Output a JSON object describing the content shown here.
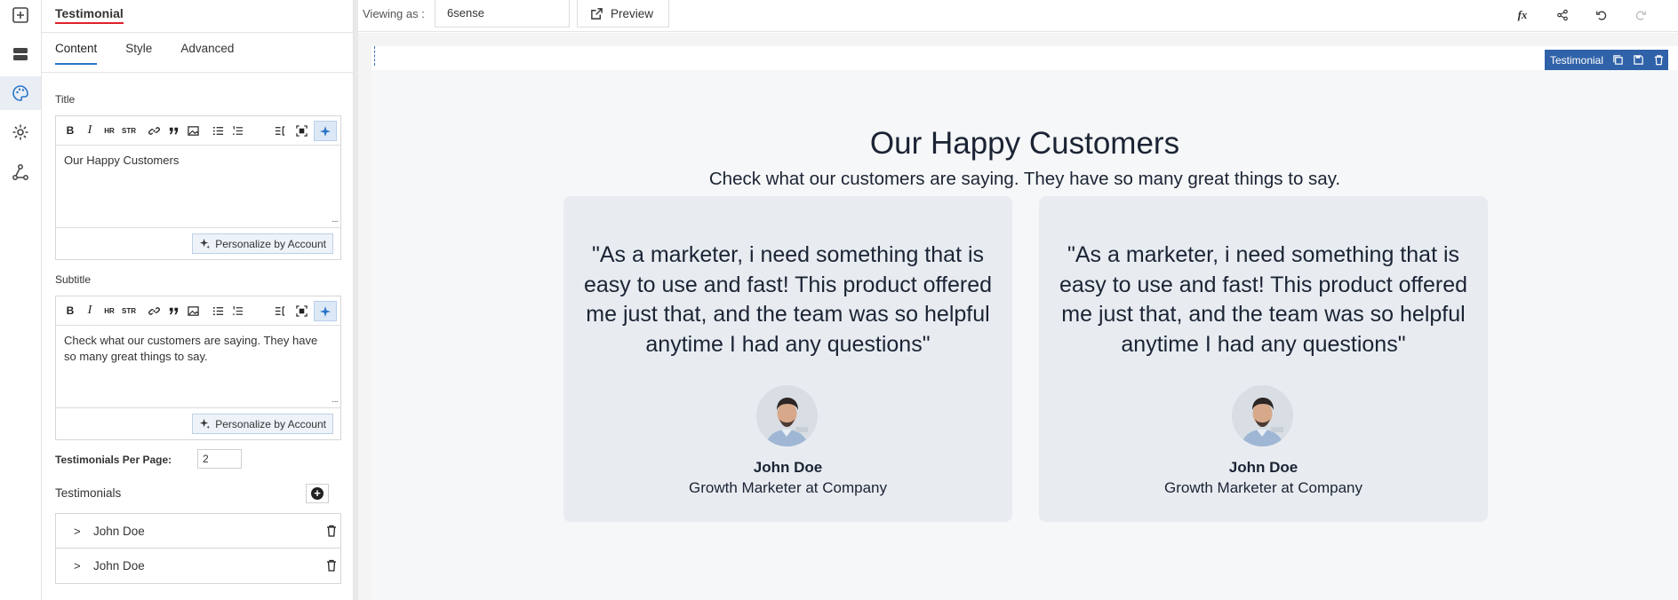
{
  "rail": {
    "icons": [
      "add-icon",
      "layout-icon",
      "palette-icon",
      "settings-icon",
      "flow-icon"
    ]
  },
  "panel": {
    "title": "Testimonial",
    "tabs": [
      {
        "label": "Content",
        "active": true
      },
      {
        "label": "Style",
        "active": false
      },
      {
        "label": "Advanced",
        "active": false
      }
    ],
    "title_field": {
      "label": "Title",
      "value": "Our Happy Customers",
      "personalize_label": "Personalize by Account"
    },
    "subtitle_field": {
      "label": "Subtitle",
      "value": "Check what our customers are saying. They have so many great things to say.",
      "personalize_label": "Personalize by Account"
    },
    "toolbar": {
      "bold": "B",
      "italic": "I",
      "hr": "HR",
      "strike": "STR"
    },
    "per_page": {
      "label": "Testimonials Per Page:",
      "value": "2"
    },
    "testimonials": {
      "label": "Testimonials",
      "items": [
        {
          "name": "John Doe"
        },
        {
          "name": "John Doe"
        }
      ]
    }
  },
  "topbar": {
    "viewing_label": "Viewing as :",
    "viewing_value": "6sense",
    "preview_label": "Preview",
    "fx_label": "fx"
  },
  "canvas": {
    "selection_tag": "Testimonial",
    "title": "Our Happy Customers",
    "subtitle": "Check what our customers are saying. They have so many great things to say.",
    "cards": [
      {
        "quote": "\"As a marketer, i need something that is easy to use and fast! This product offered me just that, and the team was so helpful anytime I had any questions\"",
        "name": "John Doe",
        "role": "Growth Marketer at Company"
      },
      {
        "quote": "\"As a marketer, i need something that is easy to use and fast! This product offered me just that, and the team was so helpful anytime I had any questions\"",
        "name": "John Doe",
        "role": "Growth Marketer at Company"
      }
    ]
  },
  "colors": {
    "accent": "#2a74c9",
    "title_underline": "#e0202a",
    "selection": "#2f62a8",
    "card_bg": "#e8ecf1",
    "text_dark": "#1b2434"
  }
}
